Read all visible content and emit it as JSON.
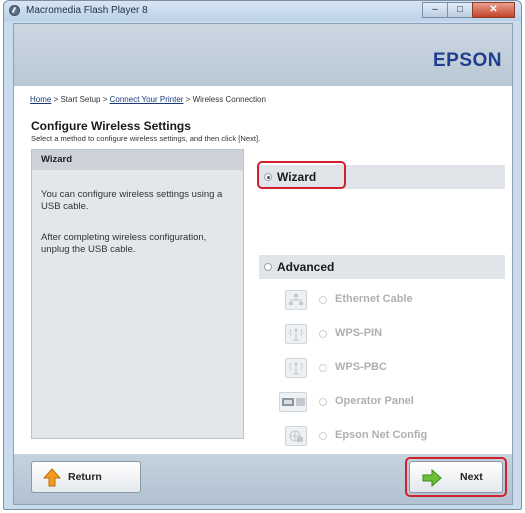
{
  "window": {
    "title": "Macromedia Flash Player 8",
    "minimize": "–",
    "maximize": "□",
    "close": "✕"
  },
  "header": {
    "brand": "EPSON"
  },
  "breadcrumb": {
    "home": "Home",
    "sep1": " > ",
    "start": "Start Setup",
    "sep2": " > ",
    "connect": "Connect Your Printer",
    "sep3": " > ",
    "current": "Wireless Connection"
  },
  "page": {
    "title": "Configure Wireless Settings",
    "subtitle": "Select a method to configure wireless settings, and then click [Next]."
  },
  "info": {
    "title": "Wizard",
    "text1": "You can configure wireless settings using a USB cable.",
    "text2": "After completing wireless configuration, unplug the USB cable."
  },
  "options": {
    "wizard": {
      "label": "Wizard",
      "selected": true
    },
    "advanced": {
      "label": "Advanced",
      "selected": false
    },
    "sub": [
      {
        "label": "Ethernet Cable",
        "icon": "ethernet-icon"
      },
      {
        "label": "WPS-PIN",
        "icon": "wps-pin-icon"
      },
      {
        "label": "WPS-PBC",
        "icon": "wps-pbc-icon"
      },
      {
        "label": "Operator Panel",
        "icon": "operator-panel-icon"
      },
      {
        "label": "Epson Net Config",
        "icon": "net-config-icon"
      }
    ]
  },
  "footer": {
    "return_label": "Return",
    "next_label": "Next"
  },
  "colors": {
    "highlight": "#d3212b",
    "brand": "#1f3e8f",
    "arrow_orange": "#f29a1f",
    "arrow_green": "#6cbf3a"
  }
}
